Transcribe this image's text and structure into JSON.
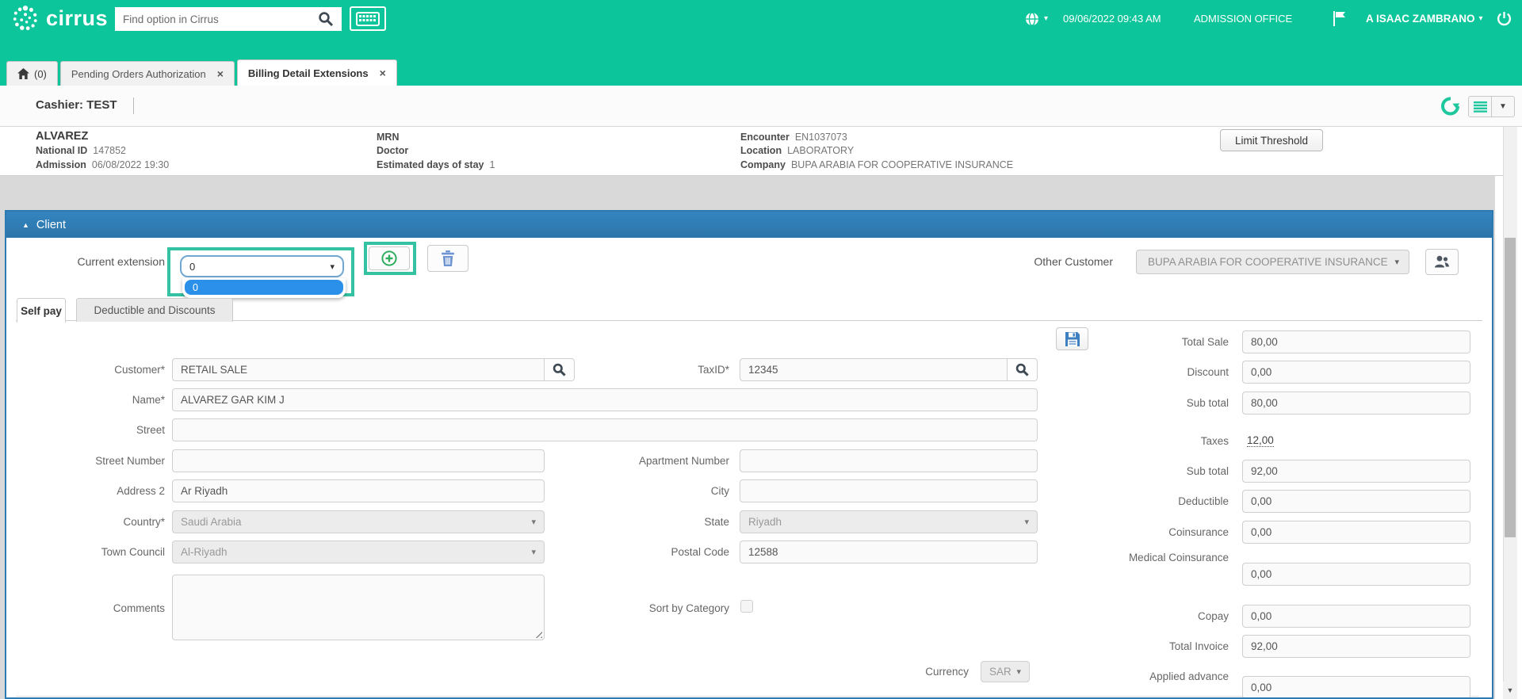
{
  "colors": {
    "accent_teal": "#0dc59a",
    "client_blue": "#2d7ab3",
    "highlight_teal": "#34c2a3",
    "selected_option_blue": "#2b90ea",
    "trash_icon_blue": "#6e95d2",
    "plus_icon_green": "#2fad5f",
    "save_icon_blue": "#3e7fc0"
  },
  "icons": {
    "caret_down": "▾",
    "collapse_up": "▲",
    "close": "×",
    "scroll_down": "▼"
  },
  "header": {
    "logo_text": "cirrus",
    "search_placeholder": "Find option in Cirrus",
    "datetime": "09/06/2022 09:43 AM",
    "office": "ADMISSION OFFICE",
    "user": "A ISAAC ZAMBRANO"
  },
  "tabs": {
    "home_count": "(0)",
    "items": [
      {
        "label": "Pending Orders Authorization"
      },
      {
        "label": "Billing Detail Extensions"
      }
    ]
  },
  "cashier": {
    "text": "Cashier: TEST"
  },
  "patient": {
    "name": "ALVAREZ",
    "col1": [
      {
        "label": "National ID",
        "value": "147852"
      },
      {
        "label": "Admission",
        "value": "06/08/2022 19:30"
      }
    ],
    "col2": [
      {
        "label": "MRN",
        "value": ""
      },
      {
        "label": "Doctor",
        "value": ""
      },
      {
        "label": "Estimated days of stay",
        "value": "1"
      }
    ],
    "col3": [
      {
        "label": "Encounter",
        "value": "EN1037073"
      },
      {
        "label": "Location",
        "value": "LABORATORY"
      },
      {
        "label": "Company",
        "value": "BUPA ARABIA FOR COOPERATIVE INSURANCE"
      }
    ],
    "limit_threshold_label": "Limit Threshold"
  },
  "client": {
    "title": "Client",
    "current_extension_label": "Current extension",
    "current_extension_value": "0",
    "open_option": "0",
    "other_customer_label": "Other Customer",
    "other_customer_value": "BUPA ARABIA FOR COOPERATIVE INSURANCE",
    "tabs": [
      "Self pay",
      "Deductible and Discounts"
    ],
    "form": {
      "customer": {
        "label": "Customer*",
        "value": "RETAIL SALE"
      },
      "taxid": {
        "label": "TaxID*",
        "value": "12345"
      },
      "name": {
        "label": "Name*",
        "value": "ALVAREZ GAR KIM J"
      },
      "street": {
        "label": "Street",
        "value": ""
      },
      "street_number": {
        "label": "Street Number",
        "value": ""
      },
      "apartment_number": {
        "label": "Apartment Number",
        "value": ""
      },
      "address2": {
        "label": "Address 2",
        "value": "Ar Riyadh"
      },
      "city": {
        "label": "City",
        "value": ""
      },
      "country": {
        "label": "Country*",
        "value": "Saudi Arabia"
      },
      "state": {
        "label": "State",
        "value": "Riyadh"
      },
      "town_council": {
        "label": "Town Council",
        "value": "Al-Riyadh"
      },
      "postal_code": {
        "label": "Postal Code",
        "value": "12588"
      },
      "comments_label": "Comments",
      "sort_by_category_label": "Sort by Category",
      "currency": {
        "label": "Currency",
        "value": "SAR"
      }
    },
    "totals": [
      {
        "label": "Total Sale",
        "value": "80,00"
      },
      {
        "label": "Discount",
        "value": "0,00"
      },
      {
        "label": "Sub total",
        "value": "80,00"
      },
      {
        "label": "Taxes",
        "value": "12,00"
      },
      {
        "label": "Sub total",
        "value": "92,00"
      },
      {
        "label": "Deductible",
        "value": "0,00"
      },
      {
        "label": "Coinsurance",
        "value": "0,00"
      },
      {
        "label": "Medical Coinsurance",
        "value": "0,00"
      },
      {
        "label": "Copay",
        "value": "0,00"
      },
      {
        "label": "Total Invoice",
        "value": "92,00"
      },
      {
        "label": "Applied advance",
        "value": "0,00"
      }
    ]
  }
}
